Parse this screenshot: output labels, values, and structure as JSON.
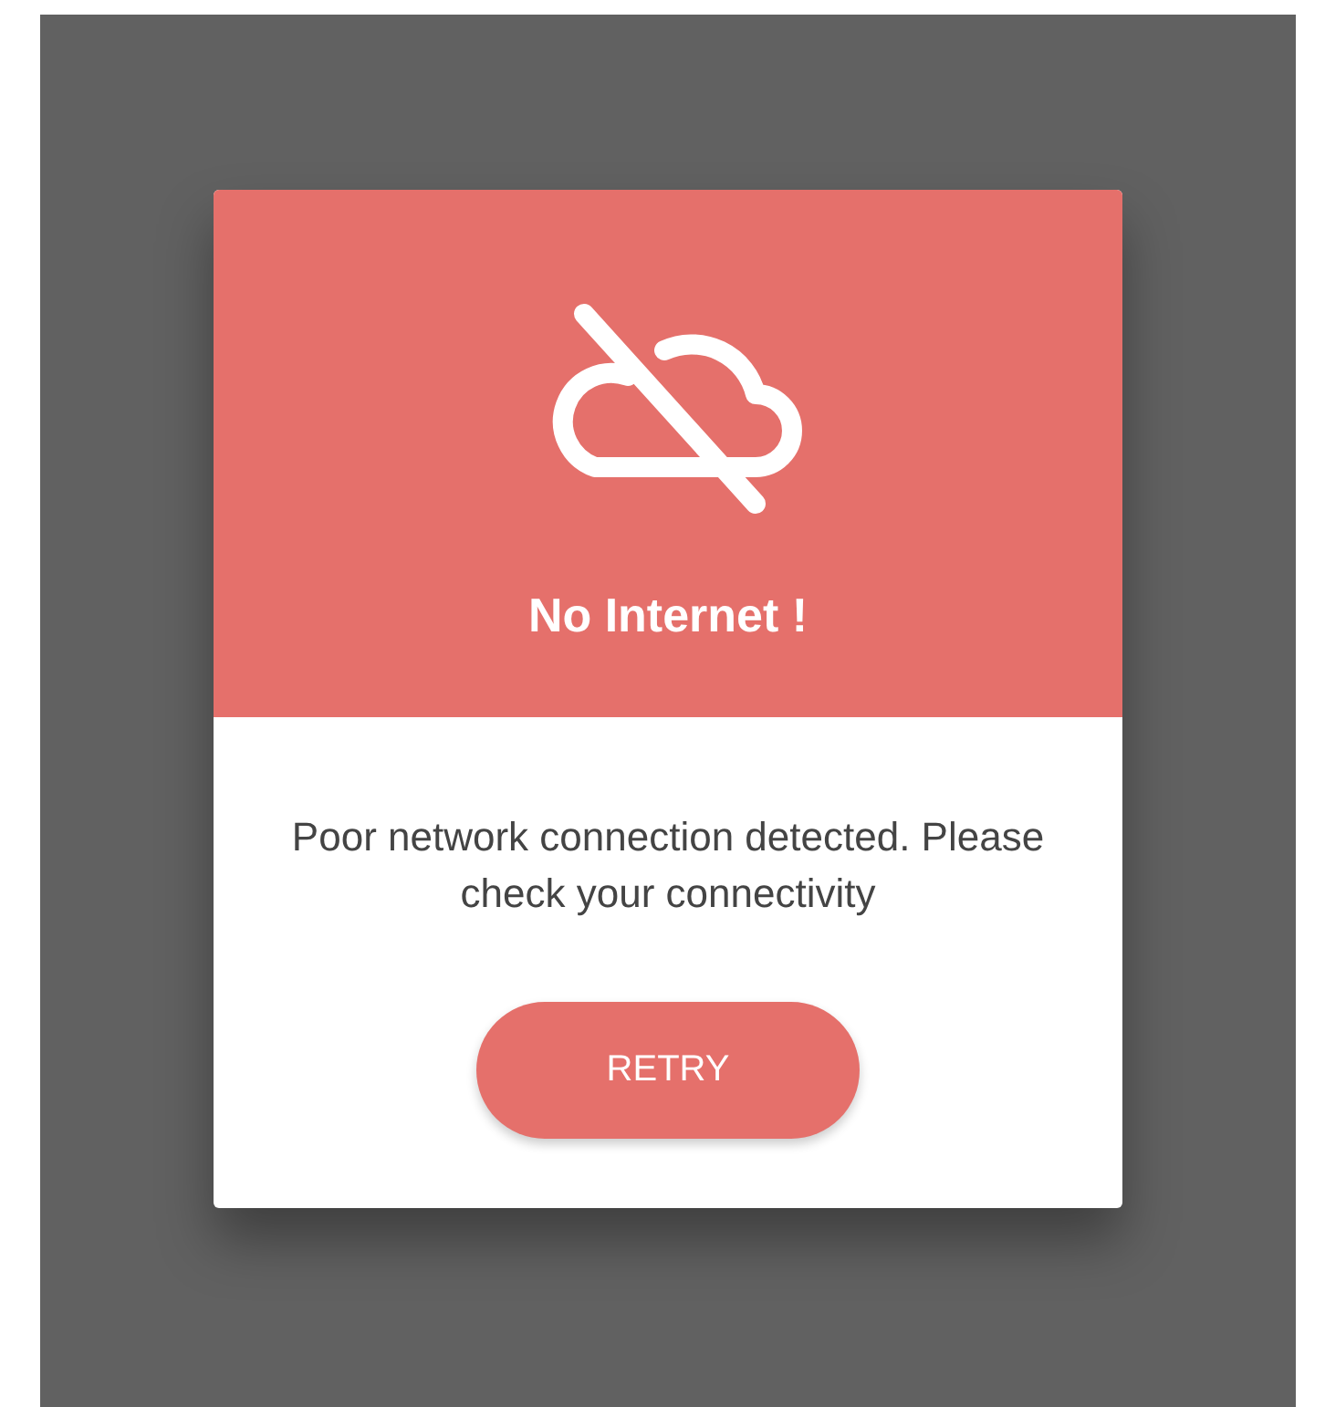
{
  "dialog": {
    "title": "No Internet !",
    "message": "Poor network connection detected. Please check your connectivity",
    "button": "RETRY"
  }
}
